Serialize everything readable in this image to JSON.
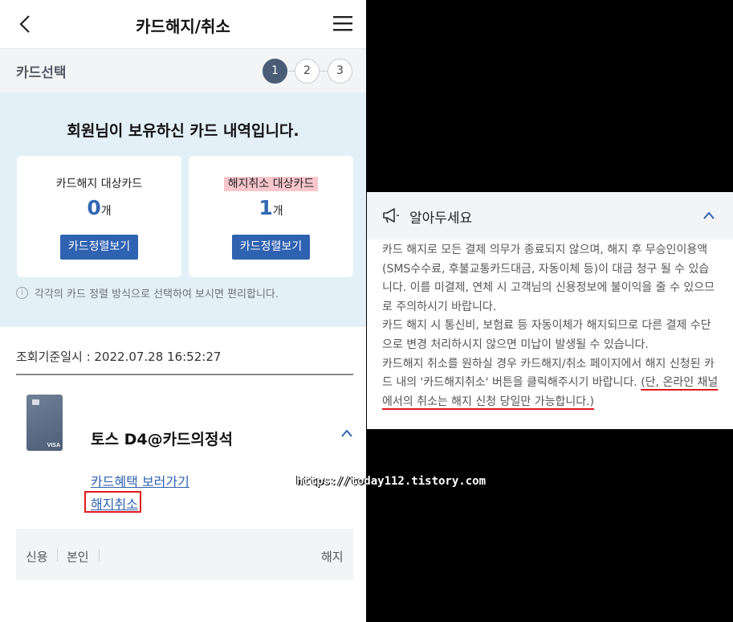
{
  "header": {
    "title": "카드해지/취소"
  },
  "steps": {
    "label": "카드선택",
    "items": [
      "1",
      "2",
      "3"
    ],
    "active": 1
  },
  "summary": {
    "title": "회원님이 보유하신 카드 내역입니다.",
    "cards": [
      {
        "label": "카드해지 대상카드",
        "count": "0",
        "unit": "개",
        "button": "카드정렬보기",
        "highlight": false
      },
      {
        "label": "해지취소 대상카드",
        "count": "1",
        "unit": "개",
        "button": "카드정렬보기",
        "highlight": true
      }
    ],
    "info": "각각의 카드 정렬 방식으로 선택하여 보시면 편리합니다."
  },
  "lookup": {
    "text": "조회기준일시 : 2022.07.28 16:52:27"
  },
  "card_item": {
    "name": "토스 D4@카드의정석",
    "brand": "VISA",
    "link_benefit": "카드혜택 보러가기",
    "link_cancel": "해지취소"
  },
  "table": {
    "col1": "신용",
    "col2": "본인",
    "col3": "해지"
  },
  "notice": {
    "title": "알아두세요",
    "para1": "카드 해지로 모든 결제 의무가 종료되지 않으며, 해지 후 무승인이용액(SMS수수료, 후불교통카드대금, 자동이체 등)이 대금 청구 될 수 있습니다. 이를 미결제, 연체 시 고객님의 신용정보에 불이익을 줄 수 있으므로 주의하시기 바랍니다.",
    "para2": "카드 해지 시 통신비, 보험료 등 자동이체가 해지되므로 다른 결제 수단으로 변경 처리하시지 않으면 미납이 발생될 수 있습니다.",
    "para3": "카드해지 취소를 원하실 경우 카드해지/취소 페이지에서 해지 신청된 카드 내의 '카드해지취소' 버튼을 클릭해주시기 바랍니다. ",
    "para3_emphasis": "(단, 온라인 채널에서의 취소는 해지 신청 당일만 가능합니다.)"
  },
  "watermark": "https://today112.tistory.com",
  "colors": {
    "accent": "#2f62b1",
    "step_active": "#4a5c76",
    "highlight_red": "#e01b1b",
    "summary_bg": "#e3f0f8"
  }
}
